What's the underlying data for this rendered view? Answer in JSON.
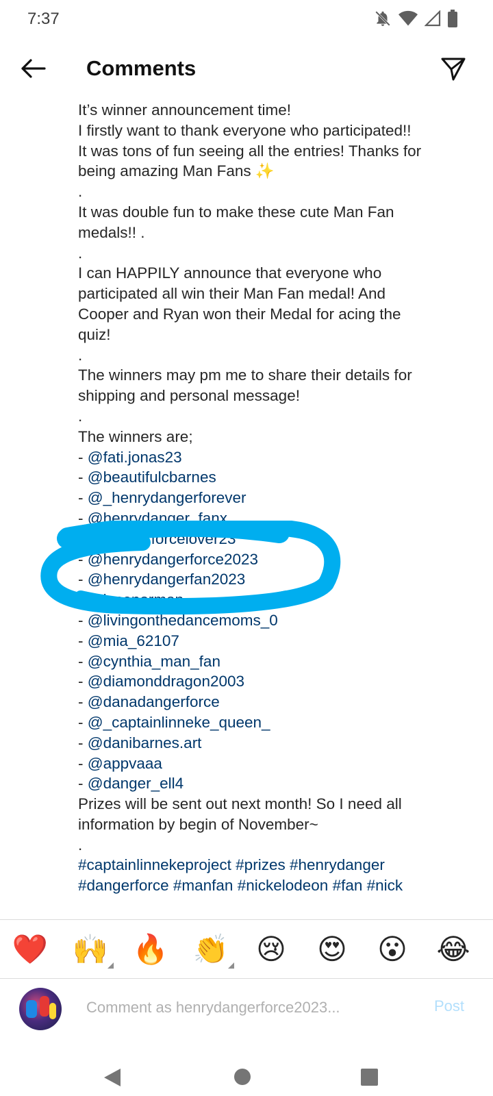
{
  "status_bar": {
    "time": "7:37"
  },
  "header": {
    "title": "Comments"
  },
  "caption": {
    "lines": [
      "It’s winner announcement time!",
      "I firstly want to thank everyone who participated!!",
      "It was tons of fun seeing all the entries! Thanks for",
      "being amazing Man Fans ✨",
      ".",
      "It was double fun to make these cute Man Fan",
      "medals!! .",
      ".",
      "I can HAPPILY announce that everyone who",
      "participated all win their Man Fan medal! And",
      "Cooper and Ryan won their Medal for acing the",
      "quiz!",
      ".",
      "The winners may pm me to share their details for",
      "shipping and personal message!",
      ".",
      "The winners are;"
    ],
    "winners": [
      "@fati.jonas23",
      "@beautifulcbarnes",
      "@_henrydangerforever",
      "@henrydanger_fanx_",
      "@dangerforcelover23",
      "@henrydangerforce2023",
      "@henrydangerfan2023",
      "@jacenorman",
      "@livingonthedancemoms_0",
      "@mia_62107",
      "@cynthia_man_fan",
      "@diamonddragon2003",
      "@danadangerforce",
      "@_captainlinneke_queen_",
      "@danibarnes.art",
      "@appvaaa",
      "@danger_ell4"
    ],
    "closing": [
      "Prizes will be sent out next month! So I need all",
      "information by begin of November~",
      "."
    ],
    "hashtags_line1": [
      "#captainlinnekeproject",
      "#prizes",
      "#henrydanger"
    ],
    "hashtags_line2": [
      "#dangerforce",
      "#manfan",
      "#nickelodeon",
      "#fan",
      "#nick"
    ]
  },
  "emoji_bar": [
    "❤️",
    "🙌",
    "🔥",
    "👏",
    "😢",
    "😍",
    "😮",
    "😂"
  ],
  "comment_box": {
    "placeholder": "Comment as henrydangerforce2023...",
    "post_label": "Post"
  },
  "colors": {
    "mention": "#00376b",
    "highlight": "#00aeef",
    "post_disabled": "#b2dffc"
  }
}
